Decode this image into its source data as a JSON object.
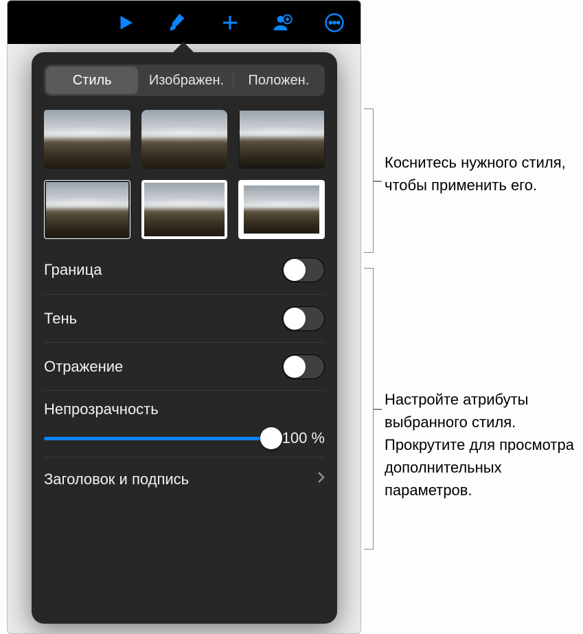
{
  "toolbar": {
    "play_icon": "play-icon",
    "format_icon": "paintbrush-icon",
    "insert_icon": "plus-icon",
    "collab_icon": "person-add-icon",
    "more_icon": "ellipsis-circle-icon"
  },
  "popover": {
    "tabs": [
      {
        "label": "Стиль",
        "selected": true
      },
      {
        "label": "Изображен.",
        "selected": false
      },
      {
        "label": "Положен.",
        "selected": false
      }
    ],
    "style_thumbs": [
      {
        "variant": "plain"
      },
      {
        "variant": "rounded"
      },
      {
        "variant": "shadow"
      },
      {
        "variant": "frame-thin"
      },
      {
        "variant": "frame-med"
      },
      {
        "variant": "frame-thick"
      }
    ],
    "rows": {
      "border_label": "Граница",
      "border_on": false,
      "shadow_label": "Тень",
      "shadow_on": false,
      "reflection_label": "Отражение",
      "reflection_on": false,
      "opacity_label": "Непрозрачность",
      "opacity_value": "100 %",
      "opacity_percent": 100,
      "title_caption_label": "Заголовок и подпись"
    },
    "accent_color": "#0a84ff"
  },
  "callouts": {
    "c1": "Коснитесь нужного стиля, чтобы применить его.",
    "c2": "Настройте атрибуты выбранного стиля. Прокрутите для просмотра дополнительных параметров."
  }
}
